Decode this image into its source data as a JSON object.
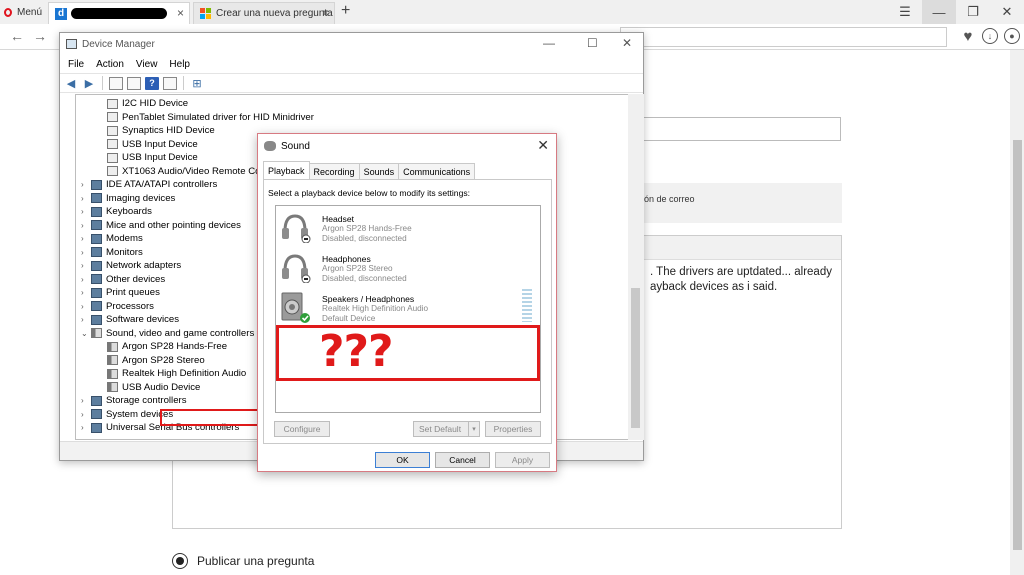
{
  "browser": {
    "menu_label": "Menú",
    "tab1": {
      "icon_letter": "d",
      "close": "×"
    },
    "tab2": {
      "title": "Crear una nueva pregunta",
      "close": "×"
    },
    "new_tab": "+",
    "controls": {
      "menu": "☰",
      "minimize": "—",
      "restore": "❐",
      "close": "✕"
    },
    "nav": {
      "back": "←",
      "forward": "→"
    }
  },
  "background_page": {
    "grey_box_text": "ión de correo",
    "body_text": ". The drivers are uptdated... already ayback devices as i said.",
    "radio_label": "Publicar una pregunta"
  },
  "device_manager": {
    "title": "Device Manager",
    "controls": {
      "minimize": "—",
      "maximize": "☐",
      "close": "✕"
    },
    "menu": [
      "File",
      "Action",
      "View",
      "Help"
    ],
    "tree": [
      "I2C HID Device",
      "PenTablet Simulated driver for HID Minidriver",
      "Synaptics HID Device",
      "USB Input Device",
      "USB Input Device",
      "XT1063 Audio/Video Remote Cont",
      "IDE ATA/ATAPI controllers",
      "Imaging devices",
      "Keyboards",
      "Mice and other pointing devices",
      "Modems",
      "Monitors",
      "Network adapters",
      "Other devices",
      "Print queues",
      "Processors",
      "Software devices",
      "Sound, video and game controllers",
      "Argon SP28 Hands-Free",
      "Argon SP28 Stereo",
      "Realtek High Definition Audio",
      "USB Audio Device",
      "Storage controllers",
      "System devices",
      "Universal Serial Bus controllers"
    ]
  },
  "sound_dialog": {
    "title": "Sound",
    "close": "✕",
    "tabs": [
      "Playback",
      "Recording",
      "Sounds",
      "Communications"
    ],
    "instruction": "Select a playback device below to modify its settings:",
    "devices": [
      {
        "name": "Headset",
        "line2": "Argon SP28 Hands-Free",
        "line3": "Disabled, disconnected",
        "icon": "headset-icon"
      },
      {
        "name": "Headphones",
        "line2": "Argon SP28 Stereo",
        "line3": "Disabled, disconnected",
        "icon": "headphones-icon"
      },
      {
        "name": "Speakers / Headphones",
        "line2": "Realtek High Definition Audio",
        "line3": "Default Device",
        "icon": "speaker-icon"
      }
    ],
    "annotation": "???",
    "buttons": {
      "configure": "Configure",
      "set_default": "Set Default",
      "properties": "Properties",
      "ok": "OK",
      "cancel": "Cancel",
      "apply": "Apply"
    }
  },
  "colors": {
    "annotation_red": "#e01a1a",
    "check_green": "#2f9e3a",
    "accent_blue": "#3c7fd4"
  }
}
